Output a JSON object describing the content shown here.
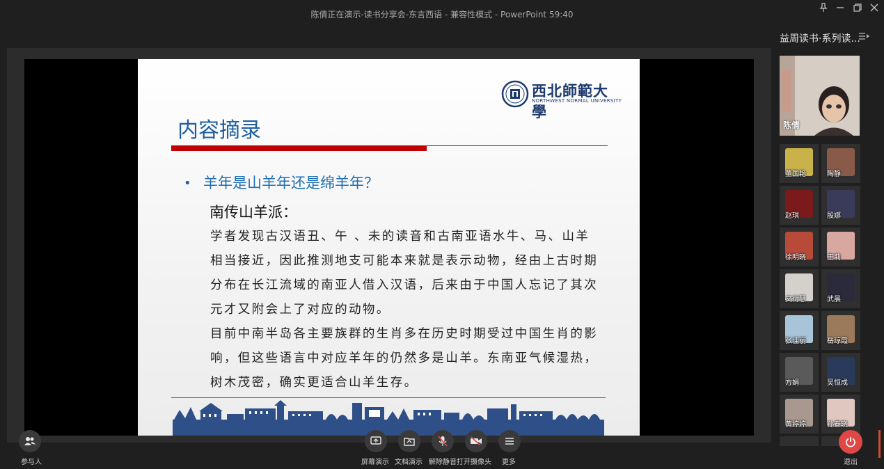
{
  "window": {
    "title": "陈倩正在演示-读书分享会-东言西语 - 兼容性模式 - PowerPoint 59:40"
  },
  "slide": {
    "logo_cn": "西北師範大學",
    "logo_en": "NORTHWEST NORMAL UNIVERSITY",
    "title": "内容摘录",
    "bullet": "羊年是山羊年还是绵羊年？",
    "subheading": "南传山羊派：",
    "para1": "学者发现古汉语丑、午 、未的读音和古南亚语水牛、马、山羊相当接近，因此推测地支可能本来就是表示动物，经由上古时期分布在长江流域的南亚人借入汉语，后来由于中国人忘记了其次元才又附会上了对应的动物。",
    "para2": "目前中南半岛各主要族群的生肖多在历史时期受过中国生肖的影响，但这些语言中对应羊年的仍然多是山羊。东南亚气候湿热，树木茂密，确实更适合山羊生存。"
  },
  "sidebar": {
    "title": "益周读书·系列读...",
    "menu_icon": "list-arrow-icon",
    "speaker_name": "陈倩",
    "participants": [
      {
        "name": "董国艳",
        "color": "#c9b24a"
      },
      {
        "name": "陶静",
        "color": "#8a5a48"
      },
      {
        "name": "赵琪",
        "color": "#7a1a1a"
      },
      {
        "name": "殷娜",
        "color": "#3a3a5a"
      },
      {
        "name": "徐明晓",
        "color": "#b84a3a"
      },
      {
        "name": "王莉",
        "color": "#d8a8a0"
      },
      {
        "name": "文衍慧",
        "color": "#d4d0cc"
      },
      {
        "name": "武晨",
        "color": "#2a2a3a"
      },
      {
        "name": "张佳丽",
        "color": "#a8c4d8"
      },
      {
        "name": "岳琼霞",
        "color": "#9a7a5a"
      },
      {
        "name": "方娟",
        "color": "#5a5a5a"
      },
      {
        "name": "吴恒成",
        "color": "#2a3a5a"
      },
      {
        "name": "黄婷婷",
        "color": "#a89890"
      },
      {
        "name": "孙春晓",
        "color": "#e0c8c0"
      }
    ]
  },
  "toolbar": {
    "participants": "参与人",
    "screen_share": "屏幕演示",
    "doc_share": "文档演示",
    "unmute": "解除静音",
    "camera": "打开摄像头",
    "more": "更多",
    "exit": "退出"
  }
}
